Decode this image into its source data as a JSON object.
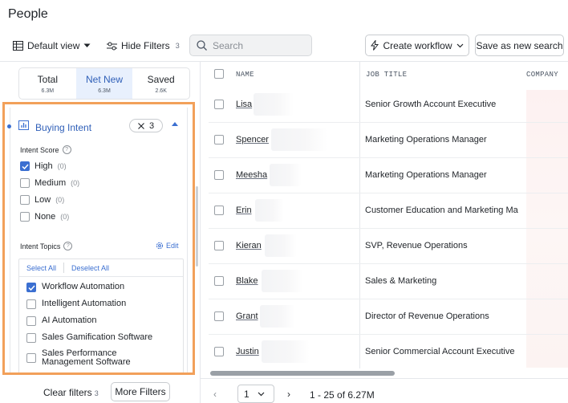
{
  "page": {
    "title": "People"
  },
  "toolbar": {
    "view_label": "Default view",
    "hide_filters_label": "Hide Filters",
    "hide_filters_count": "3",
    "search_placeholder": "Search",
    "create_workflow_label": "Create workflow",
    "save_search_label": "Save as new search"
  },
  "stats": [
    {
      "label": "Total",
      "value": "6.3M"
    },
    {
      "label": "Net New",
      "value": "6.3M",
      "active": true
    },
    {
      "label": "Saved",
      "value": "2.6K"
    }
  ],
  "buying_intent": {
    "title": "Buying Intent",
    "chip_count": "3",
    "intent_score_label": "Intent Score",
    "scores": [
      {
        "label": "High",
        "count": "(0)",
        "checked": true
      },
      {
        "label": "Medium",
        "count": "(0)",
        "checked": false
      },
      {
        "label": "Low",
        "count": "(0)",
        "checked": false
      },
      {
        "label": "None",
        "count": "(0)",
        "checked": false
      }
    ],
    "intent_topics_label": "Intent Topics",
    "edit_label": "Edit",
    "select_all": "Select All",
    "deselect_all": "Deselect All",
    "topics": [
      {
        "label": "Workflow Automation",
        "checked": true
      },
      {
        "label": "Intelligent Automation",
        "checked": false
      },
      {
        "label": "AI Automation",
        "checked": false
      },
      {
        "label": "Sales Gamification Software",
        "checked": false
      },
      {
        "label": "Sales Performance Management Software",
        "checked": false
      }
    ]
  },
  "footer": {
    "clear_filters_label": "Clear filters",
    "clear_filters_count": "3",
    "more_filters_label": "More Filters"
  },
  "table": {
    "columns": [
      "NAME",
      "JOB TITLE",
      "COMPANY"
    ],
    "rows": [
      {
        "name": "Lisa",
        "title": "Senior Growth Account Executive"
      },
      {
        "name": "Spencer",
        "title": "Marketing Operations Manager"
      },
      {
        "name": "Meesha",
        "title": "Marketing Operations Manager"
      },
      {
        "name": "Erin",
        "title": "Customer Education and Marketing Ma"
      },
      {
        "name": "Kieran",
        "title": "SVP, Revenue Operations"
      },
      {
        "name": "Blake",
        "title": "Sales & Marketing"
      },
      {
        "name": "Grant",
        "title": "Director of Revenue Operations"
      },
      {
        "name": "Justin",
        "title": "Senior Commercial Account Executive"
      }
    ]
  },
  "pagination": {
    "prev": "‹",
    "page": "1",
    "next": "›",
    "range": "1 - 25 of 6.27M"
  },
  "colors": {
    "accent": "#3b6fd1",
    "highlight_border": "#f2a05a"
  }
}
